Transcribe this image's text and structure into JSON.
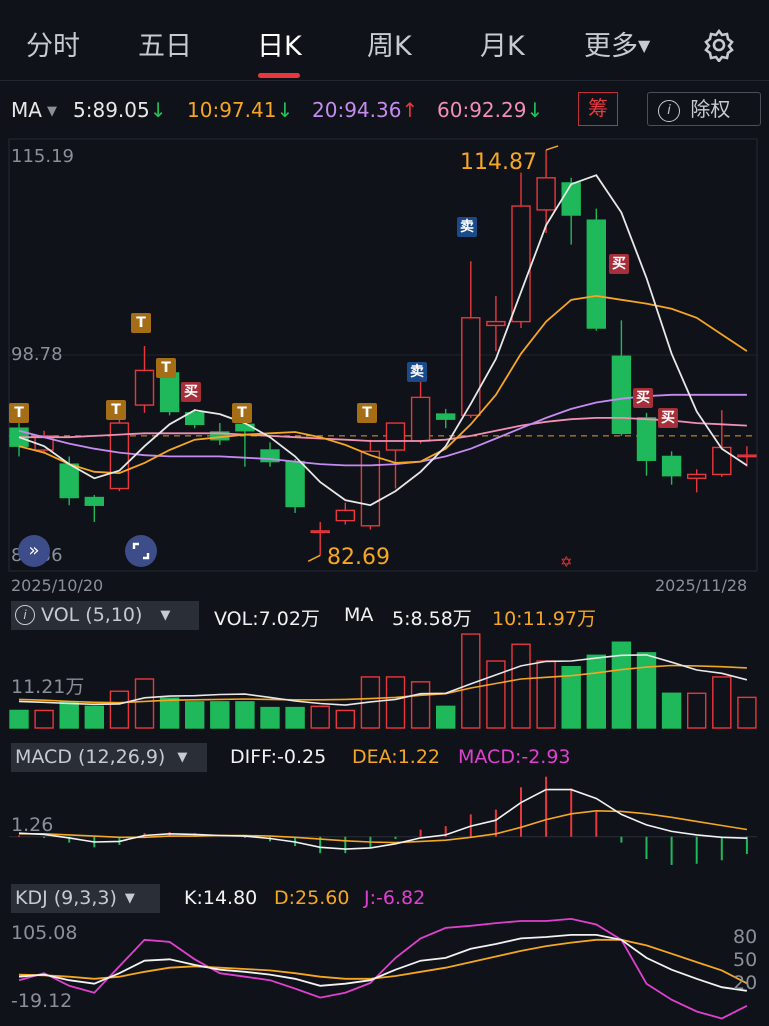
{
  "tabs": [
    {
      "label": "分时",
      "active": false
    },
    {
      "label": "五日",
      "active": false
    },
    {
      "label": "日K",
      "active": true
    },
    {
      "label": "周K",
      "active": false
    },
    {
      "label": "月K",
      "active": false
    },
    {
      "label": "更多",
      "active": false
    }
  ],
  "settings_icon": "gear-icon",
  "ma_bar": {
    "label": "MA",
    "items": [
      {
        "text": "5:89.05",
        "arrow": "↓",
        "color": "#e8e8e8",
        "arrow_color": "#22c05c"
      },
      {
        "text": "10:97.41",
        "arrow": "↓",
        "color": "#f5a623",
        "arrow_color": "#22c05c"
      },
      {
        "text": "20:94.36",
        "arrow": "↑",
        "color": "#c68bf0",
        "arrow_color": "#e8383d"
      },
      {
        "text": "60:92.29",
        "arrow": "↓",
        "color": "#f28fb5",
        "arrow_color": "#22c05c"
      }
    ],
    "chip_label": "筹",
    "adjust_label": "除权"
  },
  "price_axis": {
    "top": "115.19",
    "mid": "98.78",
    "bottom": "82.36",
    "min_value": 82.36,
    "max_value": 115.19
  },
  "dates": {
    "start": "2025/10/20",
    "end": "2025/11/28"
  },
  "extremes": {
    "high_label": "114.87",
    "low_label": "82.69"
  },
  "chart_data": {
    "type": "candlestick",
    "title": "",
    "xlabel": "",
    "ylabel": "",
    "ylim": [
      82.36,
      115.19
    ],
    "candles": [
      {
        "o": 93.2,
        "c": 91.8,
        "h": 94.1,
        "l": 91.0
      },
      {
        "o": 91.5,
        "c": 92.6,
        "h": 93.0,
        "l": 91.2
      },
      {
        "o": 90.4,
        "c": 87.8,
        "h": 91.0,
        "l": 87.2
      },
      {
        "o": 87.8,
        "c": 87.2,
        "h": 88.0,
        "l": 85.9
      },
      {
        "o": 88.5,
        "c": 93.6,
        "h": 94.0,
        "l": 88.3
      },
      {
        "o": 95.0,
        "c": 97.7,
        "h": 99.6,
        "l": 94.4
      },
      {
        "o": 97.5,
        "c": 94.5,
        "h": 97.9,
        "l": 94.2
      },
      {
        "o": 94.4,
        "c": 93.5,
        "h": 94.7,
        "l": 93.2
      },
      {
        "o": 92.9,
        "c": 92.3,
        "h": 93.6,
        "l": 91.9
      },
      {
        "o": 93.5,
        "c": 93.0,
        "h": 94.4,
        "l": 90.2
      },
      {
        "o": 91.5,
        "c": 90.6,
        "h": 92.1,
        "l": 90.2
      },
      {
        "o": 90.6,
        "c": 87.1,
        "h": 90.8,
        "l": 86.6
      },
      {
        "o": 85.2,
        "c": 85.2,
        "h": 85.9,
        "l": 83.3
      },
      {
        "o": 86.0,
        "c": 86.8,
        "h": 87.4,
        "l": 85.7
      },
      {
        "o": 85.6,
        "c": 91.4,
        "h": 92.3,
        "l": 85.3
      },
      {
        "o": 91.5,
        "c": 93.6,
        "h": 93.6,
        "l": 88.5
      },
      {
        "o": 92.2,
        "c": 95.6,
        "h": 97.2,
        "l": 92.0
      },
      {
        "o": 94.3,
        "c": 93.9,
        "h": 94.7,
        "l": 93.2
      },
      {
        "o": 94.2,
        "c": 101.8,
        "h": 106.2,
        "l": 94.0
      },
      {
        "o": 101.2,
        "c": 101.5,
        "h": 103.5,
        "l": 99.2
      },
      {
        "o": 101.5,
        "c": 110.5,
        "h": 113.1,
        "l": 101.0
      },
      {
        "o": 110.2,
        "c": 112.7,
        "h": 114.87,
        "l": 108.4
      },
      {
        "o": 112.3,
        "c": 109.8,
        "h": 112.7,
        "l": 107.5
      },
      {
        "o": 109.4,
        "c": 101.0,
        "h": 110.3,
        "l": 100.8
      },
      {
        "o": 98.8,
        "c": 92.8,
        "h": 101.6,
        "l": 92.6
      },
      {
        "o": 94.0,
        "c": 90.7,
        "h": 94.4,
        "l": 89.5
      },
      {
        "o": 91.0,
        "c": 89.5,
        "h": 91.4,
        "l": 88.8
      },
      {
        "o": 89.3,
        "c": 89.6,
        "h": 90.0,
        "l": 88.2
      },
      {
        "o": 89.6,
        "c": 91.7,
        "h": 94.6,
        "l": 89.4
      },
      {
        "o": 91.1,
        "c": 91.1,
        "h": 91.8,
        "l": 90.2
      }
    ],
    "ma5": [
      92.5,
      91.8,
      90.4,
      89.3,
      89.9,
      91.8,
      93.5,
      94.6,
      94.3,
      93.6,
      92.5,
      91.0,
      89.0,
      87.6,
      87.2,
      88.3,
      89.8,
      91.8,
      95.1,
      98.6,
      103.8,
      109.0,
      112.2,
      112.9,
      110.0,
      104.9,
      99.0,
      94.5,
      91.6,
      90.3
    ],
    "ma10": [
      91.8,
      91.3,
      90.4,
      89.8,
      89.7,
      90.5,
      91.5,
      92.3,
      92.5,
      92.7,
      92.8,
      92.9,
      92.5,
      91.9,
      91.1,
      90.5,
      90.6,
      91.6,
      93.5,
      95.8,
      99.0,
      101.5,
      103.2,
      103.5,
      103.2,
      102.9,
      102.5,
      101.8,
      100.5,
      99.2
    ],
    "ma20": [
      93.0,
      92.5,
      92.0,
      91.6,
      91.3,
      91.1,
      91.0,
      91.0,
      91.0,
      90.9,
      90.8,
      90.6,
      90.4,
      90.3,
      90.3,
      90.4,
      90.6,
      91.0,
      91.6,
      92.4,
      93.2,
      94.0,
      94.7,
      95.2,
      95.5,
      95.7,
      95.8,
      95.8,
      95.8,
      95.8
    ],
    "ma60": [
      92.5,
      92.5,
      92.5,
      92.6,
      92.7,
      92.8,
      92.8,
      92.8,
      92.8,
      92.7,
      92.6,
      92.5,
      92.4,
      92.3,
      92.2,
      92.2,
      92.2,
      92.3,
      92.6,
      93.0,
      93.4,
      93.7,
      93.9,
      94.0,
      94.0,
      93.9,
      93.8,
      93.6,
      93.5,
      93.4
    ],
    "volume": {
      "label": "VOL (5,10)",
      "vol_text": "VOL:7.02万",
      "ma5_text": "5:8.58万",
      "ma10_text": "10:11.97万",
      "axis_label": "11.21万",
      "values": [
        4.3,
        4.3,
        6.4,
        5.3,
        9.0,
        12.0,
        7.3,
        6.4,
        6.4,
        6.4,
        5.0,
        5.0,
        5.3,
        4.3,
        12.5,
        12.5,
        11.3,
        5.3,
        23.0,
        16.4,
        20.5,
        16.4,
        15.0,
        17.8,
        21.0,
        18.4,
        8.5,
        8.5,
        12.5,
        7.5
      ],
      "ma5": [
        6.5,
        6.3,
        6.0,
        5.8,
        5.9,
        7.4,
        7.8,
        7.9,
        8.2,
        8.3,
        7.5,
        6.6,
        6.0,
        5.6,
        6.4,
        7.0,
        8.4,
        8.5,
        10.8,
        13.0,
        15.2,
        16.3,
        16.4,
        17.1,
        17.8,
        17.9,
        16.1,
        14.2,
        13.4,
        11.8
      ],
      "ma10": [
        7.0,
        6.8,
        6.5,
        6.3,
        6.2,
        6.5,
        6.8,
        6.9,
        7.0,
        7.1,
        7.0,
        6.9,
        6.9,
        7.0,
        7.2,
        7.5,
        8.0,
        8.4,
        9.8,
        10.9,
        12.0,
        12.4,
        12.8,
        13.5,
        14.3,
        14.9,
        15.3,
        15.2,
        15.0,
        14.7
      ]
    },
    "macd": {
      "label": "MACD (12,26,9)",
      "diff_text": "DIFF:-0.25",
      "dea_text": "DEA:1.22",
      "macd_text": "MACD:-2.93",
      "axis_label": "1.26",
      "diff": [
        0.6,
        0.4,
        -0.2,
        -0.9,
        -0.8,
        0.2,
        0.5,
        0.4,
        0.2,
        0.1,
        -0.3,
        -0.9,
        -1.8,
        -2.1,
        -1.9,
        -1.2,
        -0.2,
        0.3,
        1.8,
        2.8,
        5.8,
        8.0,
        8.0,
        6.5,
        3.8,
        2.0,
        0.9,
        0.3,
        -0.1,
        -0.25
      ],
      "dea": [
        0.5,
        0.5,
        0.3,
        0.1,
        -0.1,
        -0.1,
        0.1,
        0.1,
        0.2,
        0.2,
        0.1,
        -0.1,
        -0.4,
        -0.7,
        -0.9,
        -1.0,
        -0.8,
        -0.6,
        -0.1,
        0.5,
        1.6,
        2.9,
        3.9,
        4.4,
        4.3,
        3.9,
        3.3,
        2.6,
        1.9,
        1.22
      ],
      "hist": [
        0.2,
        -0.2,
        -1.0,
        -1.8,
        -1.4,
        0.6,
        0.8,
        0.6,
        0.0,
        -0.2,
        -0.8,
        -1.6,
        -2.8,
        -2.8,
        -2.0,
        -0.4,
        1.2,
        1.8,
        3.8,
        4.6,
        8.4,
        10.2,
        8.2,
        4.2,
        -1.0,
        -3.8,
        -4.8,
        -4.6,
        -4.0,
        -2.93
      ]
    },
    "kdj": {
      "label": "KDJ (9,3,3)",
      "k_text": "K:14.80",
      "d_text": "D:25.60",
      "j_text": "J:-6.82",
      "axis_top": "105.08",
      "axis_bottom": "-19.12",
      "right_ticks": [
        "80",
        "50",
        "20"
      ],
      "k": [
        35,
        38,
        30,
        25,
        40,
        58,
        60,
        52,
        45,
        42,
        38,
        32,
        22,
        25,
        30,
        45,
        58,
        62,
        75,
        82,
        90,
        92,
        95,
        95,
        88,
        62,
        45,
        32,
        20,
        14.8
      ],
      "d": [
        38,
        37,
        35,
        32,
        35,
        42,
        48,
        50,
        48,
        46,
        44,
        40,
        35,
        32,
        32,
        36,
        42,
        48,
        56,
        64,
        72,
        79,
        84,
        88,
        88,
        80,
        68,
        56,
        44,
        25.6
      ],
      "j": [
        30,
        40,
        22,
        12,
        50,
        88,
        85,
        60,
        40,
        35,
        30,
        18,
        5,
        12,
        26,
        62,
        90,
        105,
        108,
        112,
        115,
        115,
        118,
        110,
        88,
        25,
        2,
        -15,
        -25,
        -6.82
      ]
    }
  }
}
